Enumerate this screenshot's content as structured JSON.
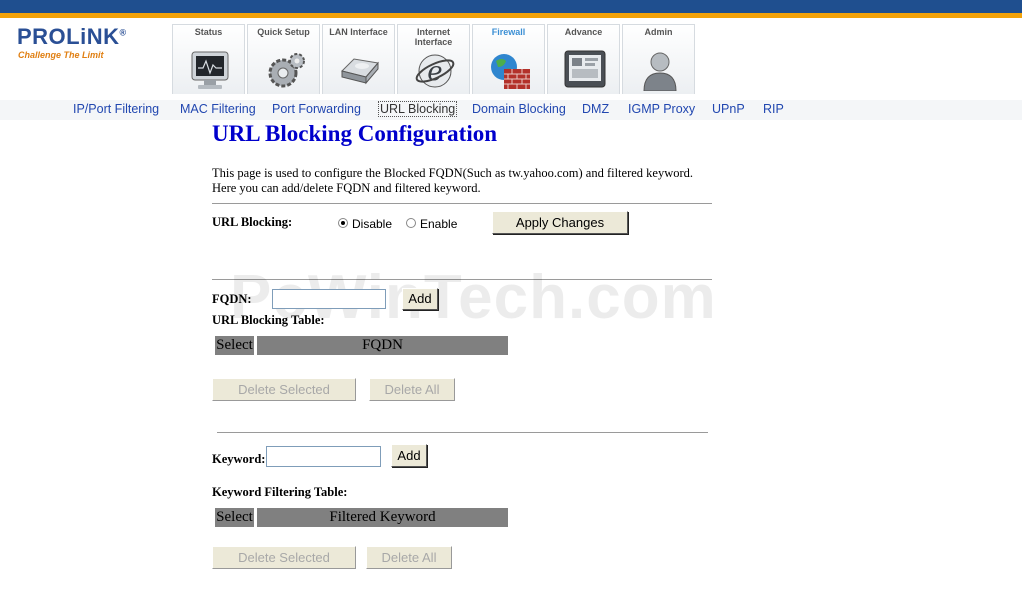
{
  "brand": {
    "name": "PROLiNK",
    "mark": "®",
    "tagline": "Challenge The Limit",
    "colors": {
      "top_bar": "#1f4f8f",
      "accent_bar": "#f2a20a",
      "title": "#0000cc",
      "link": "#2147b0",
      "table_header": "#808080"
    }
  },
  "tabs": [
    {
      "label": "Status",
      "icon": "monitor-icon"
    },
    {
      "label": "Quick Setup",
      "icon": "gears-icon"
    },
    {
      "label": "LAN Interface",
      "icon": "drive-icon"
    },
    {
      "label": "Internet\nInterface",
      "icon": "internet-explorer-icon"
    },
    {
      "label": "Firewall",
      "icon": "firewall-globe-icon",
      "active": true
    },
    {
      "label": "Advance",
      "icon": "advance-screen-icon"
    },
    {
      "label": "Admin",
      "icon": "admin-user-icon"
    }
  ],
  "subnav": [
    {
      "label": "IP/Port Filtering"
    },
    {
      "label": "MAC Filtering"
    },
    {
      "label": "Port Forwarding"
    },
    {
      "label": "URL Blocking",
      "active": true
    },
    {
      "label": "Domain Blocking"
    },
    {
      "label": "DMZ"
    },
    {
      "label": "IGMP Proxy"
    },
    {
      "label": "UPnP"
    },
    {
      "label": "RIP"
    }
  ],
  "page": {
    "title": "URL Blocking Configuration",
    "description": "This page is used to configure the Blocked FQDN(Such as tw.yahoo.com) and filtered keyword. Here you can add/delete FQDN and filtered keyword."
  },
  "url_blocking": {
    "label": "URL Blocking:",
    "disable_label": "Disable",
    "enable_label": "Enable",
    "selected": "Disable",
    "apply_label": "Apply Changes"
  },
  "fqdn": {
    "label": "FQDN:",
    "value": "",
    "add_label": "Add",
    "table_title": "URL Blocking Table:",
    "columns": [
      "Select",
      "FQDN"
    ],
    "delete_selected_label": "Delete Selected",
    "delete_all_label": "Delete All"
  },
  "keyword": {
    "label": "Keyword:",
    "value": "",
    "add_label": "Add",
    "table_title": "Keyword Filtering Table:",
    "columns": [
      "Select",
      "Filtered Keyword"
    ],
    "delete_selected_label": "Delete Selected",
    "delete_all_label": "Delete All"
  },
  "watermark": "PcWinTech.com"
}
